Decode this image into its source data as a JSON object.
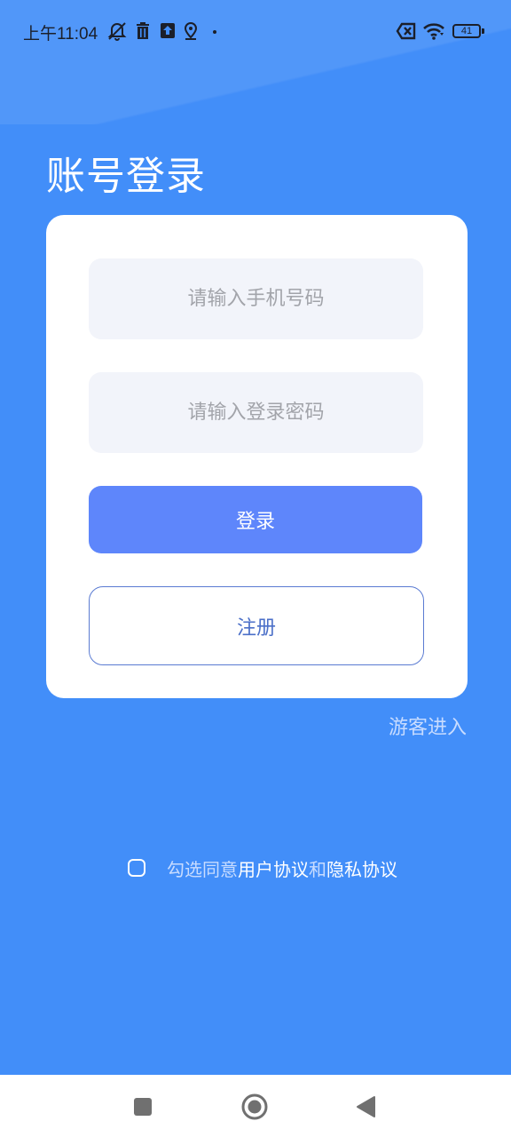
{
  "status_bar": {
    "time": "上午11:04",
    "battery": "41",
    "icons": [
      "mute-bell-icon",
      "trash-icon",
      "upload-icon",
      "location-icon",
      "dot-icon",
      "sim-x-icon",
      "wifi-icon",
      "battery-icon"
    ]
  },
  "login": {
    "title": "账号登录",
    "phone_placeholder": "请输入手机号码",
    "password_placeholder": "请输入登录密码",
    "login_label": "登录",
    "register_label": "注册",
    "guest_label": "游客进入"
  },
  "agreement": {
    "prefix": "勾选同意",
    "user_agreement": "用户协议",
    "and": "和",
    "privacy_policy": "隐私协议"
  },
  "nav": {
    "icons": [
      "recents-square-icon",
      "home-circle-icon",
      "back-triangle-icon"
    ]
  },
  "colors": {
    "background": "#428ef9",
    "primary_button": "#5e86fb",
    "register_border": "#5a7bd2",
    "field_bg": "#f2f4fa"
  }
}
